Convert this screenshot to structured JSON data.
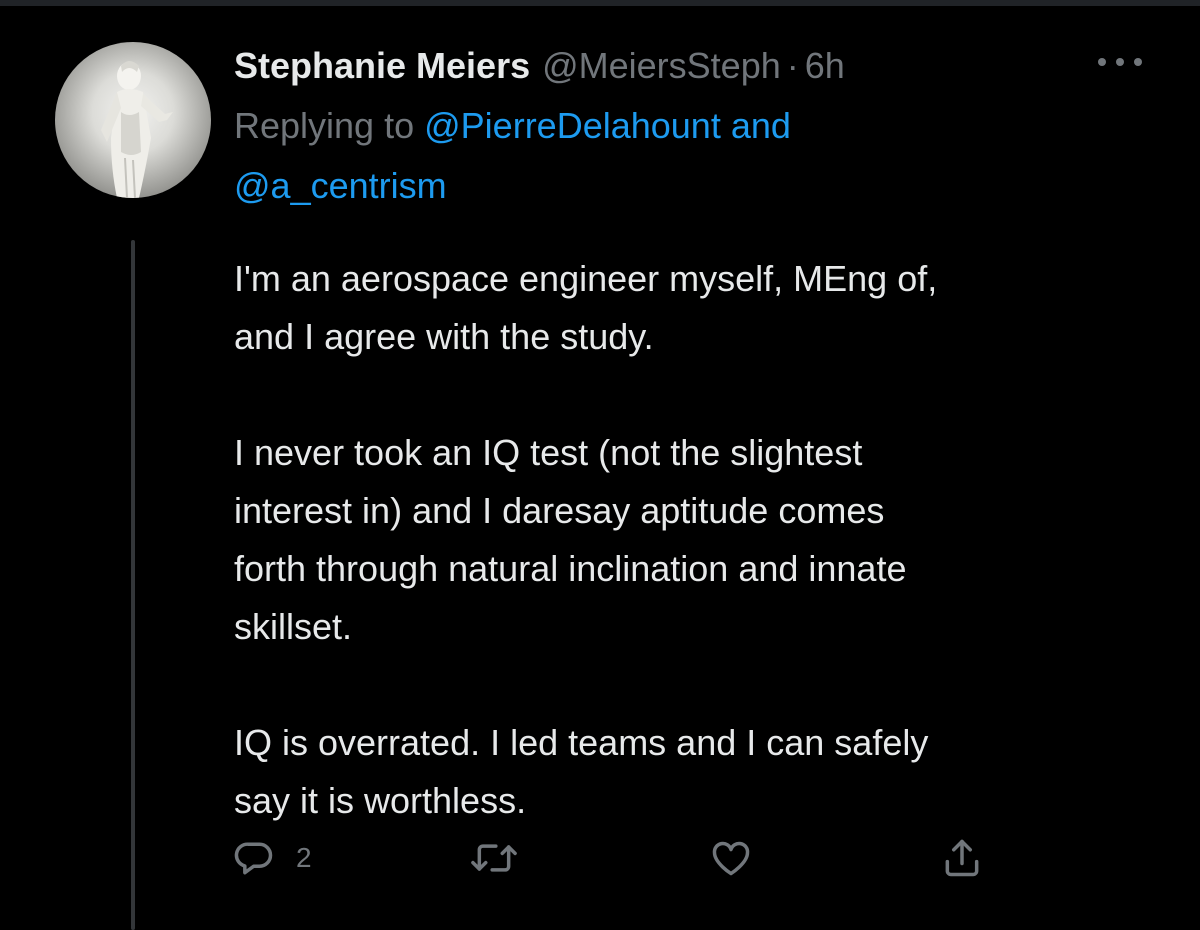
{
  "tweet": {
    "display_name": "Stephanie Meiers",
    "handle": "@MeiersSteph",
    "separator": "·",
    "time": "6h",
    "replying_prefix": "Replying to",
    "reply_mention_1": "@PierreDelahount",
    "reply_joiner": "and",
    "reply_mention_2": "@a_centrism",
    "text": "I'm an aerospace engineer myself, MEng of,\nand I agree with the study.\n\nI never took an IQ test (not the slightest\ninterest in) and I daresay aptitude comes\nforth through natural inclination and innate\nskillset.\n\nIQ is overrated. I led teams and I can safely\nsay it is worthless.",
    "reply_count": "2"
  },
  "icons": {
    "more": "more-horizontal-icon",
    "reply": "reply-bubble-icon",
    "retweet": "retweet-icon",
    "like": "heart-icon",
    "share": "share-icon"
  },
  "colors": {
    "background": "#000000",
    "primary_text": "#e7e9ea",
    "secondary_text": "#71767b",
    "link": "#1d9bf0",
    "thread_line": "#333639"
  }
}
